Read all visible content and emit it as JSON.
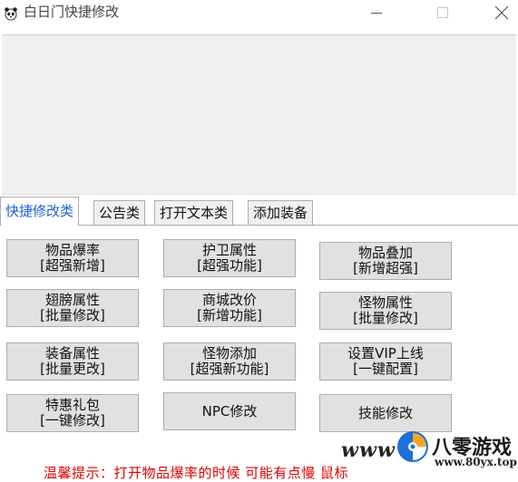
{
  "window": {
    "title": "白日门快捷修改",
    "icon": "panda-icon"
  },
  "tabs": [
    {
      "label": "快捷修改类",
      "active": true
    },
    {
      "label": "公告类",
      "active": false
    },
    {
      "label": "打开文本类",
      "active": false
    },
    {
      "label": "添加装备",
      "active": false
    }
  ],
  "buttons": [
    {
      "line1": "物品爆率",
      "line2": "[超强新增]"
    },
    {
      "line1": "护卫属性",
      "line2": "[超强功能]"
    },
    {
      "line1": "物品叠加",
      "line2": "[新增超强]"
    },
    {
      "line1": "翅膀属性",
      "line2": "[批量修改]"
    },
    {
      "line1": "商城改价",
      "line2": "[新增功能]"
    },
    {
      "line1": "怪物属性",
      "line2": "[批量修改]"
    },
    {
      "line1": "装备属性",
      "line2": "[批量更改]"
    },
    {
      "line1": "怪物添加",
      "line2": "[超强新功能]"
    },
    {
      "line1": "设置VIP上线",
      "line2": "[一键配置]"
    },
    {
      "line1": "特惠礼包",
      "line2": "[一键修改]"
    },
    {
      "line1": "NPC修改",
      "line2": ""
    },
    {
      "line1": "技能修改",
      "line2": ""
    }
  ],
  "notice": "温馨提示：打开物品爆率的时候 可能有点慢 鼠标",
  "watermark": {
    "www": "www",
    "name": "八零游戏",
    "url": "www.80yx.top"
  },
  "colors": {
    "active_tab_text": "#1f5fd6",
    "notice_text": "#e00000",
    "button_bg": "#e1e1e1",
    "panel_bg": "#f0f0f0"
  }
}
